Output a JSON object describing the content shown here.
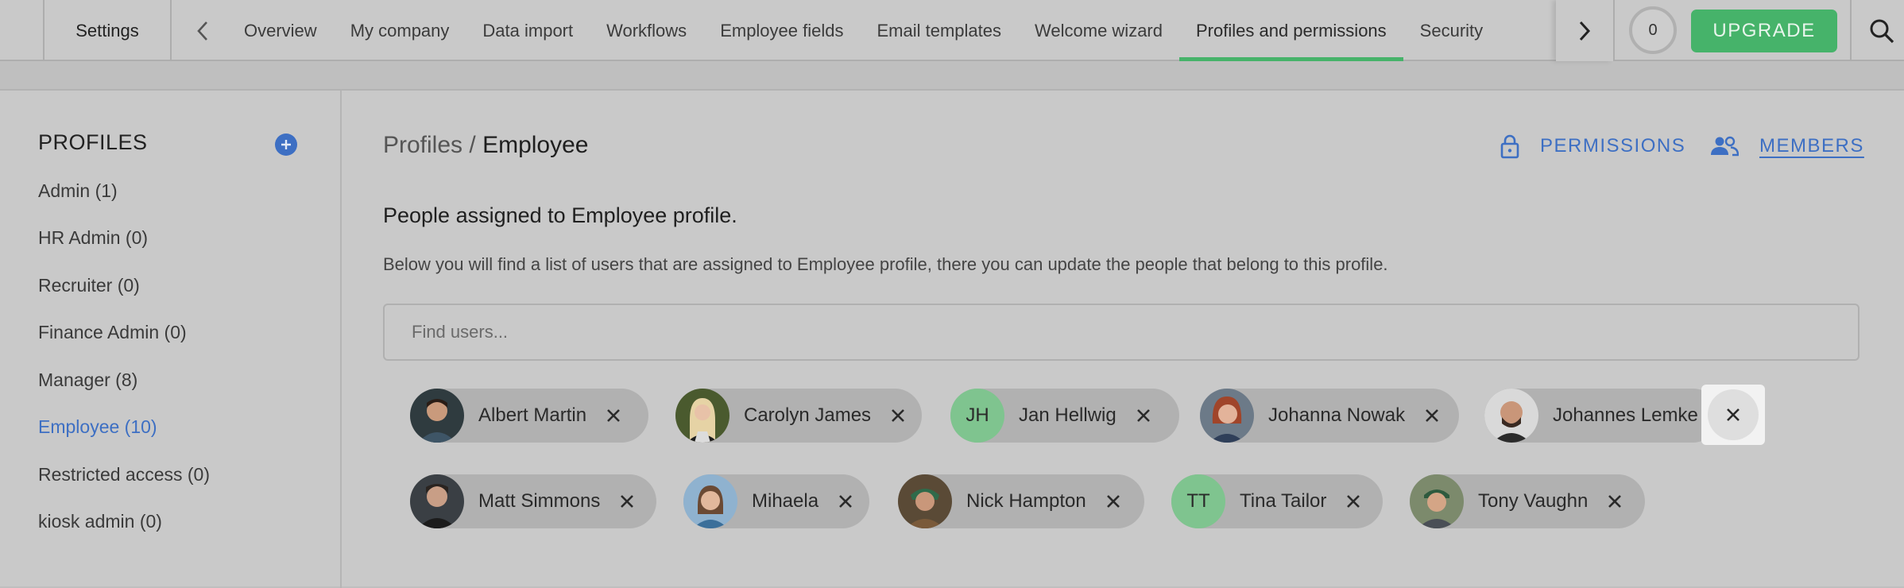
{
  "topbar": {
    "settings_label": "Settings",
    "tabs": [
      {
        "label": "Overview"
      },
      {
        "label": "My company"
      },
      {
        "label": "Data import"
      },
      {
        "label": "Workflows"
      },
      {
        "label": "Employee fields"
      },
      {
        "label": "Email templates"
      },
      {
        "label": "Welcome wizard"
      },
      {
        "label": "Profiles and permissions",
        "active": true
      },
      {
        "label": "Security"
      }
    ],
    "counter": "0",
    "upgrade_label": "UPGRADE",
    "icons": {
      "prev": "chevron-left-icon",
      "next": "chevron-right-icon",
      "search": "search-icon"
    },
    "accent_color": "#46b36a"
  },
  "sidebar": {
    "header": "PROFILES",
    "add_icon": "plus-circle-icon",
    "items": [
      {
        "label": "Admin (1)"
      },
      {
        "label": "HR Admin (0)"
      },
      {
        "label": "Recruiter (0)"
      },
      {
        "label": "Finance Admin (0)"
      },
      {
        "label": "Manager (8)"
      },
      {
        "label": "Employee (10)",
        "active": true
      },
      {
        "label": "Restricted access (0)"
      },
      {
        "label": "kiosk admin (0)"
      }
    ],
    "active_color": "#3d6fc3"
  },
  "main": {
    "breadcrumb": {
      "parent": "Profiles",
      "separator": " / ",
      "current": "Employee"
    },
    "permissions_label": "PERMISSIONS",
    "members_label": "MEMBERS",
    "section_title": "People assigned to Employee profile.",
    "section_desc": "Below you will find a list of users that are assigned to Employee profile, there you can update the people that belong to this profile.",
    "search": {
      "placeholder": "Find users...",
      "value": ""
    },
    "members": [
      {
        "name": "Albert Martin",
        "avatar": "photo"
      },
      {
        "name": "Carolyn James",
        "avatar": "photo"
      },
      {
        "name": "Jan Hellwig",
        "initials": "JH"
      },
      {
        "name": "Johanna Nowak",
        "avatar": "photo"
      },
      {
        "name": "Johannes Lemke",
        "avatar": "photo"
      },
      {
        "name": "Matt Simmons",
        "avatar": "photo"
      },
      {
        "name": "Mihaela",
        "avatar": "photo"
      },
      {
        "name": "Nick Hampton",
        "avatar": "photo"
      },
      {
        "name": "Tina Tailor",
        "initials": "TT"
      },
      {
        "name": "Tony Vaughn",
        "avatar": "photo"
      }
    ]
  }
}
